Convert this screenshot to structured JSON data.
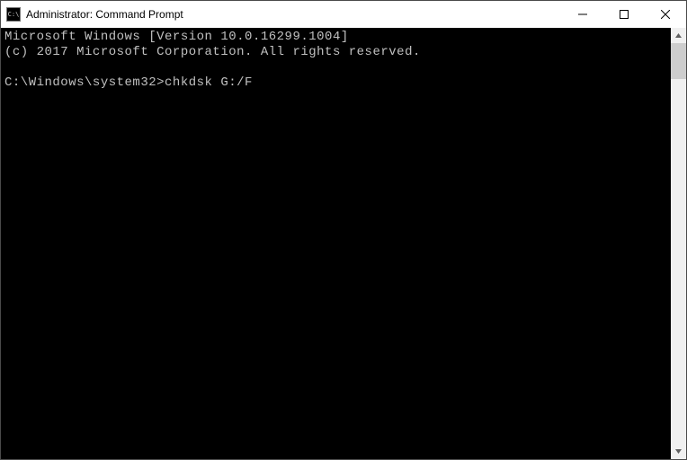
{
  "window": {
    "title": "Administrator: Command Prompt"
  },
  "terminal": {
    "line1": "Microsoft Windows [Version 10.0.16299.1004]",
    "line2": "(c) 2017 Microsoft Corporation. All rights reserved.",
    "blank": "",
    "prompt": "C:\\Windows\\system32>",
    "command": "chkdsk G:/F"
  }
}
